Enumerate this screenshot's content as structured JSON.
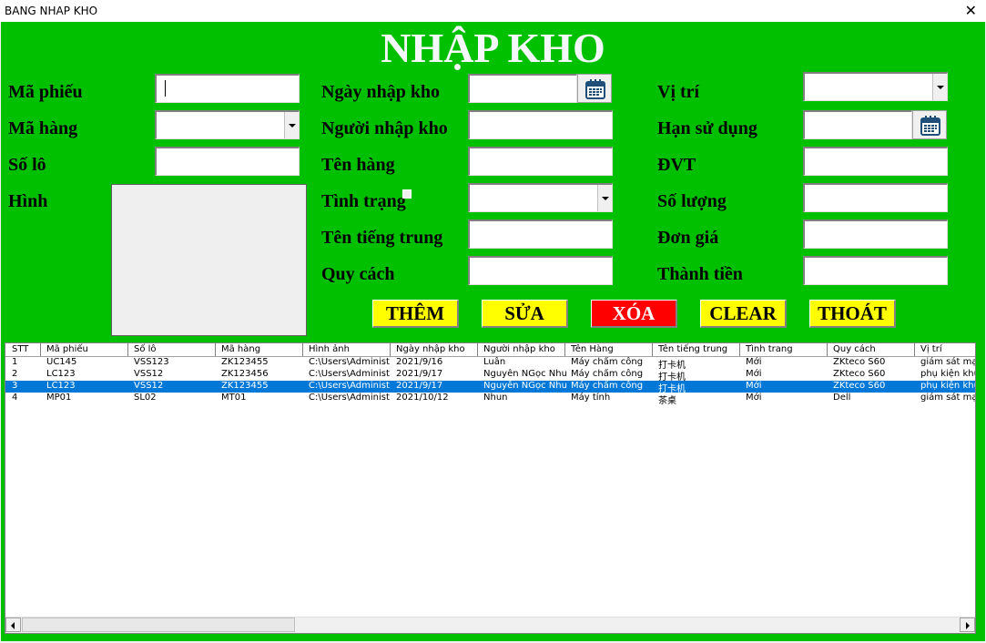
{
  "window": {
    "title": "BANG NHAP KHO",
    "close_label": "✕"
  },
  "heading": "NHẬP KHO",
  "fields": {
    "ma_phieu": {
      "label": "Mã phiếu",
      "value": ""
    },
    "ma_hang": {
      "label": "Mã hàng",
      "value": ""
    },
    "so_lo": {
      "label": "Số lô",
      "value": ""
    },
    "hinh": {
      "label": "Hình"
    },
    "ngay_nhap_kho": {
      "label": "Ngày nhập kho",
      "value": ""
    },
    "nguoi_nhap_kho": {
      "label": "Người nhập kho",
      "value": ""
    },
    "ten_hang": {
      "label": "Tên hàng",
      "value": ""
    },
    "tinh_trang": {
      "label": "Tình trạng",
      "value": ""
    },
    "ten_tieng_trung": {
      "label": "Tên tiếng trung",
      "value": ""
    },
    "quy_cach": {
      "label": "Quy cách",
      "value": ""
    },
    "vi_tri": {
      "label": "Vị trí",
      "value": ""
    },
    "han_su_dung": {
      "label": "Hạn sử dụng",
      "value": ""
    },
    "dvt": {
      "label": "ĐVT",
      "value": ""
    },
    "so_luong": {
      "label": "Số lượng",
      "value": ""
    },
    "don_gia": {
      "label": "Đơn giá",
      "value": ""
    },
    "thanh_tien": {
      "label": "Thành tiền",
      "value": ""
    }
  },
  "buttons": {
    "them": "THÊM",
    "sua": "SỬA",
    "xoa": "XÓA",
    "clear": "CLEAR",
    "thoat": "THOÁT"
  },
  "colors": {
    "form_bg": "#00c000",
    "button_yellow": "#ffff00",
    "button_red": "#ff0000",
    "selection": "#0078d7"
  },
  "table": {
    "columns": [
      "STT",
      "Mã phiếu",
      "Số lô",
      "Mã hàng",
      "Hình ảnh",
      "Ngày nhập kho",
      "Người nhập kho",
      "Tên Hàng",
      "Tên tiếng trung",
      "Tình trang",
      "Quy cách",
      "Vị trí"
    ],
    "selected_row": 2,
    "rows": [
      [
        "1",
        "UC145",
        "VSS123",
        "ZK123455",
        "C:\\Users\\Administ",
        "2021/9/16",
        "Luân",
        "Máy chấm công",
        "打卡机",
        "Mới",
        "ZKteco S60",
        "giám sát mạ"
      ],
      [
        "2",
        "LC123",
        "VSS12",
        "ZK123456",
        "C:\\Users\\Administ",
        "2021/9/17",
        "Nguyễn NGọc Nhu",
        "Máy chấm công",
        "打卡机",
        "Mới",
        "ZKteco S60",
        "phụ kiện khu"
      ],
      [
        "3",
        "LC123",
        "VSS12",
        "ZK123455",
        "C:\\Users\\Administ",
        "2021/9/17",
        "Nguyễn NGọc Nhu",
        "Máy chấm công",
        "打卡机",
        "Mới",
        "ZKteco S60",
        "phụ kiện khu"
      ],
      [
        "4",
        "MP01",
        "SL02",
        "MT01",
        "C:\\Users\\Administ",
        "2021/10/12",
        "Nhun",
        "Máy tính",
        "茶桌",
        "Mới",
        "Dell",
        "giám sát mạ"
      ]
    ]
  }
}
